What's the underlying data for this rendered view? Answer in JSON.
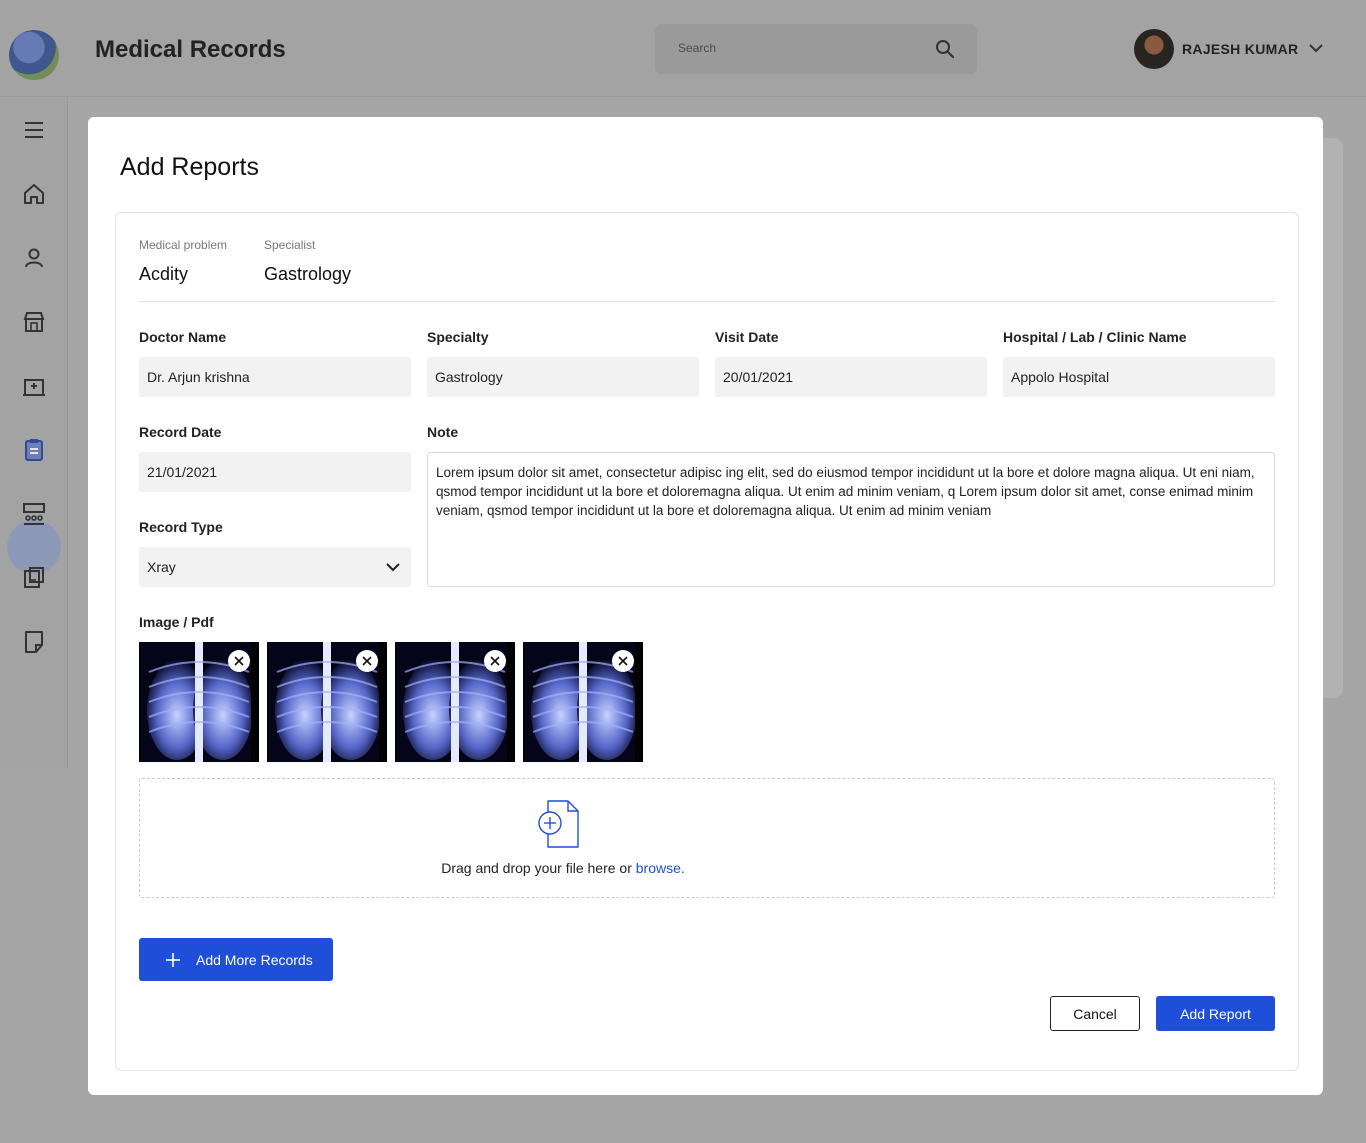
{
  "header": {
    "title": "Medical Records",
    "search_placeholder": "Search",
    "user_name": "RAJESH KUMAR"
  },
  "sidebar": {
    "items": [
      {
        "icon": "menu-icon"
      },
      {
        "icon": "home-icon"
      },
      {
        "icon": "user-icon"
      },
      {
        "icon": "store-icon"
      },
      {
        "icon": "hospital-icon"
      },
      {
        "icon": "clipboard-icon",
        "active": true
      },
      {
        "icon": "group-icon"
      },
      {
        "icon": "records-icon"
      },
      {
        "icon": "note-icon"
      }
    ]
  },
  "modal": {
    "title": "Add Reports",
    "summary": {
      "problem_label": "Medical problem",
      "problem_value": "Acdity",
      "specialist_label": "Specialist",
      "specialist_value": "Gastrology"
    },
    "fields": {
      "doctor_label": "Doctor Name",
      "doctor_value": "Dr. Arjun krishna",
      "specialty_label": "Specialty",
      "specialty_value": "Gastrology",
      "visit_label": "Visit Date",
      "visit_value": "20/01/2021",
      "hospital_label": "Hospital / Lab / Clinic Name",
      "hospital_value": "Appolo Hospital",
      "record_date_label": "Record Date",
      "record_date_value": "21/01/2021",
      "record_type_label": "Record Type",
      "record_type_value": "Xray",
      "note_label": "Note",
      "note_value": "Lorem ipsum dolor sit amet, consectetur adipisc ing elit, sed do eiusmod tempor incididunt ut la bore et dolore magna aliqua. Ut eni niam, qsmod tempor incididunt ut la bore et doloremagna aliqua. Ut enim ad minim  veniam, q Lorem ipsum dolor sit amet, conse enimad minim  veniam, qsmod tempor incididunt ut la bore et doloremagna aliqua. Ut enim ad minim  veniam"
    },
    "attachments": {
      "label": "Image / Pdf",
      "count": 4,
      "dropzone_text": "Drag and drop your file here or ",
      "dropzone_link": "browse."
    },
    "buttons": {
      "add_more": "Add More Records",
      "cancel": "Cancel",
      "submit": "Add Report"
    }
  },
  "colors": {
    "accent": "#1f4fd8",
    "overlay": "#a6a6a6"
  }
}
